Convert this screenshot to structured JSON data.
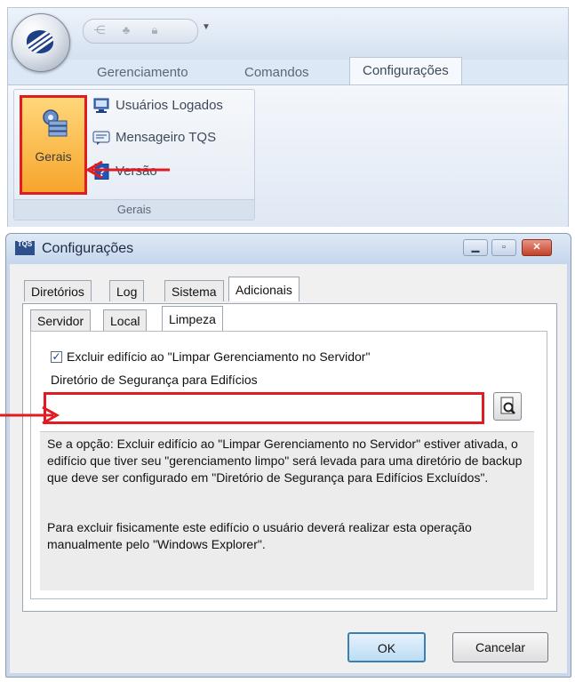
{
  "ribbon": {
    "tabs": [
      {
        "label": "Gerenciamento"
      },
      {
        "label": "Comandos"
      },
      {
        "label": "Configurações"
      }
    ],
    "group": {
      "label": "Gerais",
      "big_button": {
        "label": "Gerais",
        "icon": "gear-stack-icon"
      },
      "items": [
        {
          "label": "Usuários Logados",
          "icon": "users-logged-icon"
        },
        {
          "label": "Mensageiro TQS",
          "icon": "messenger-icon"
        },
        {
          "label": "Versão",
          "icon": "help-version-icon"
        }
      ]
    }
  },
  "dialog": {
    "title": "Configurações",
    "icon_text": "TQS",
    "main_tabs": [
      {
        "label": "Diretórios"
      },
      {
        "label": "Log"
      },
      {
        "label": "Sistema"
      },
      {
        "label": "Adicionais"
      }
    ],
    "sub_tabs": [
      {
        "label": "Servidor"
      },
      {
        "label": "Local"
      },
      {
        "label": "Limpeza"
      }
    ],
    "checkbox": {
      "label": "Excluir edifício ao \"Limpar Gerenciamento no Servidor\"",
      "checked": true
    },
    "directory": {
      "label": "Diretório de Segurança para Edifícios",
      "value": ""
    },
    "info_paragraph_1": "Se a opção: Excluir edifício ao \"Limpar Gerenciamento no Servidor\" estiver ativada, o edifício que tiver seu \"gerenciamento limpo\" será levada para uma diretório de backup que deve ser configurado em \"Diretório de Segurança para Edifícios Excluídos\".",
    "info_paragraph_2": "Para excluir fisicamente este edifício o usuário deverá realizar esta operação manualmente pelo \"Windows Explorer\".",
    "ok_label": "OK",
    "cancel_label": "Cancelar"
  },
  "colors": {
    "highlight": "#e11b22",
    "ribbon_active": "#f7a52b"
  }
}
